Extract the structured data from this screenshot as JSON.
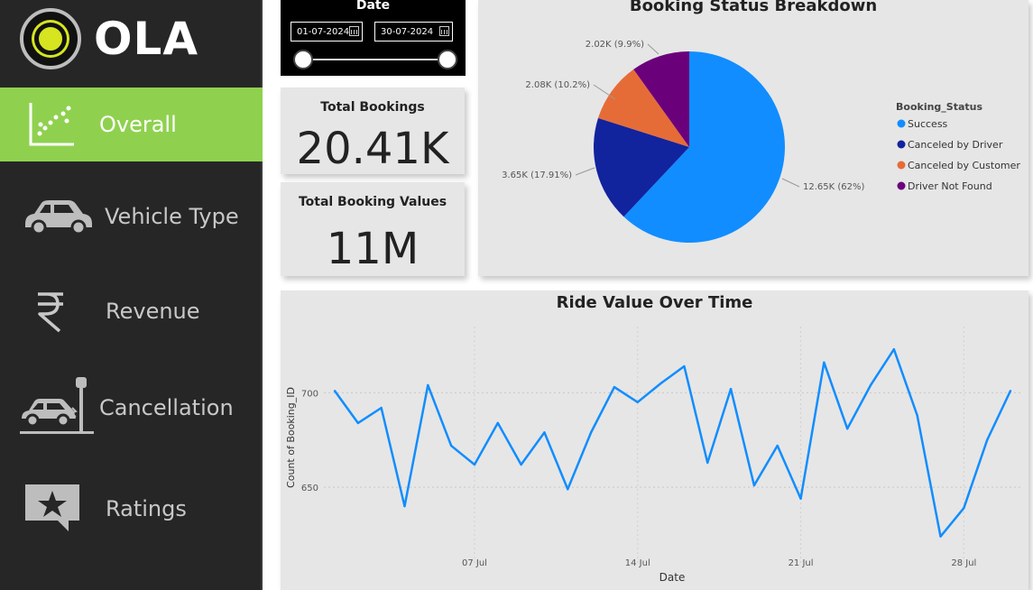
{
  "logo": {
    "text": "OLA"
  },
  "nav": {
    "overall": "Overall",
    "vehicle_type": "Vehicle Type",
    "revenue": "Revenue",
    "cancellation": "Cancellation",
    "ratings": "Ratings"
  },
  "date_filter": {
    "title": "Date",
    "start": "01-07-2024",
    "end": "30-07-2024"
  },
  "kpis": {
    "total_bookings_label": "Total Bookings",
    "total_bookings_value": "20.41K",
    "total_values_label": "Total Booking Values",
    "total_values_value": "11M"
  },
  "colors": {
    "sidebar_bg": "#262626",
    "active_nav": "#8fd14f",
    "success": "#118dff",
    "canceled_driver": "#12239e",
    "canceled_customer": "#e66c37",
    "driver_not_found": "#6b007b",
    "line": "#118dff"
  },
  "chart_data": [
    {
      "type": "pie",
      "title": "Booking Status Breakdown",
      "legend_title": "Booking_Status",
      "legend_position": "right",
      "slices": [
        {
          "name": "Success",
          "label": "12.65K (62%)",
          "value": 12650
        },
        {
          "name": "Canceled by Driver",
          "label": "3.65K (17.91%)",
          "value": 3650
        },
        {
          "name": "Canceled by Customer",
          "label": "2.08K (10.2%)",
          "value": 2080
        },
        {
          "name": "Driver Not Found",
          "label": "2.02K (9.9%)",
          "value": 2020
        }
      ]
    },
    {
      "type": "line",
      "title": "Ride Value Over Time",
      "xlabel": "Date",
      "ylabel": "Count of Booking_ID",
      "x_ticks": [
        {
          "day": 7,
          "label": "07 Jul"
        },
        {
          "day": 14,
          "label": "14 Jul"
        },
        {
          "day": 21,
          "label": "21 Jul"
        },
        {
          "day": 28,
          "label": "28 Jul"
        }
      ],
      "y_ticks": [
        650,
        700
      ],
      "ylim": [
        610,
        735
      ],
      "grid": true,
      "x": [
        1,
        2,
        3,
        4,
        5,
        6,
        7,
        8,
        9,
        10,
        11,
        12,
        13,
        14,
        15,
        16,
        17,
        18,
        19,
        20,
        21,
        22,
        23,
        24,
        25,
        26,
        27,
        28,
        29,
        30
      ],
      "values": [
        701,
        684,
        692,
        640,
        704,
        672,
        662,
        684,
        662,
        679,
        649,
        679,
        703,
        695,
        705,
        714,
        663,
        702,
        651,
        672,
        644,
        716,
        681,
        704,
        723,
        688,
        624,
        639,
        675,
        701
      ]
    }
  ]
}
